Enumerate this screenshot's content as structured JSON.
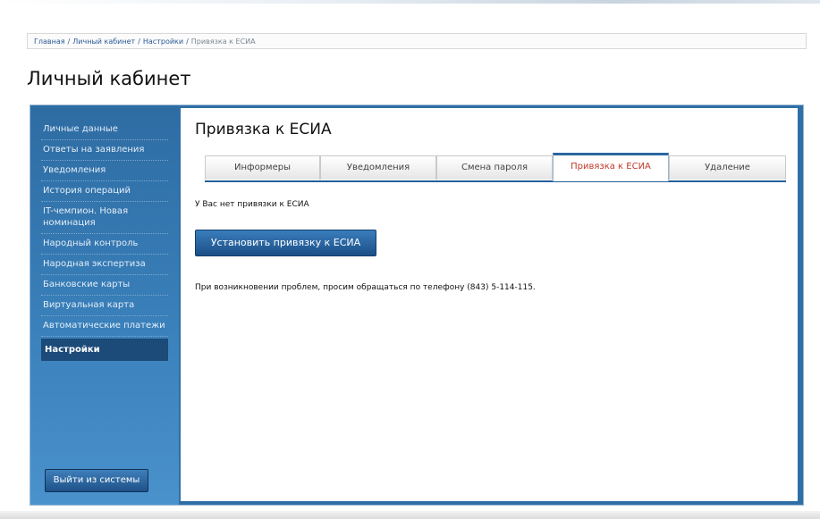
{
  "breadcrumb": {
    "items": [
      "Главная",
      "Личный кабинет",
      "Настройки"
    ],
    "current": "Привязка к ЕСИА"
  },
  "page_title": "Личный кабинет",
  "sidebar": {
    "items": [
      {
        "label": "Личные данные"
      },
      {
        "label": "Ответы на заявления"
      },
      {
        "label": "Уведомления"
      },
      {
        "label": "История операций"
      },
      {
        "label": "IT-чемпион. Новая номинация"
      },
      {
        "label": "Народный контроль"
      },
      {
        "label": "Народная экспертиза"
      },
      {
        "label": "Банковские карты"
      },
      {
        "label": "Виртуальная карта"
      },
      {
        "label": "Автоматические платежи"
      },
      {
        "label": "Настройки"
      }
    ],
    "active_index": 10,
    "logout_label": "Выйти из системы"
  },
  "content": {
    "title": "Привязка к ЕСИА",
    "tabs": [
      {
        "label": "Информеры"
      },
      {
        "label": "Уведомления"
      },
      {
        "label": "Смена пароля"
      },
      {
        "label": "Привязка к ЕСИА"
      },
      {
        "label": "Удаление"
      }
    ],
    "active_tab_index": 3,
    "no_binding_text": "У Вас нет привязки к ЕСИА",
    "bind_button_label": "Установить привязку к ЕСИА",
    "help_text": "При возникновении проблем, просим обращаться по телефону (843) 5-114-115."
  },
  "colors": {
    "sidebar_bg": "#2f6fa6",
    "active_item_bg": "#1c4b7a",
    "active_tab_text": "#c0392b",
    "link": "#2a5a96"
  }
}
